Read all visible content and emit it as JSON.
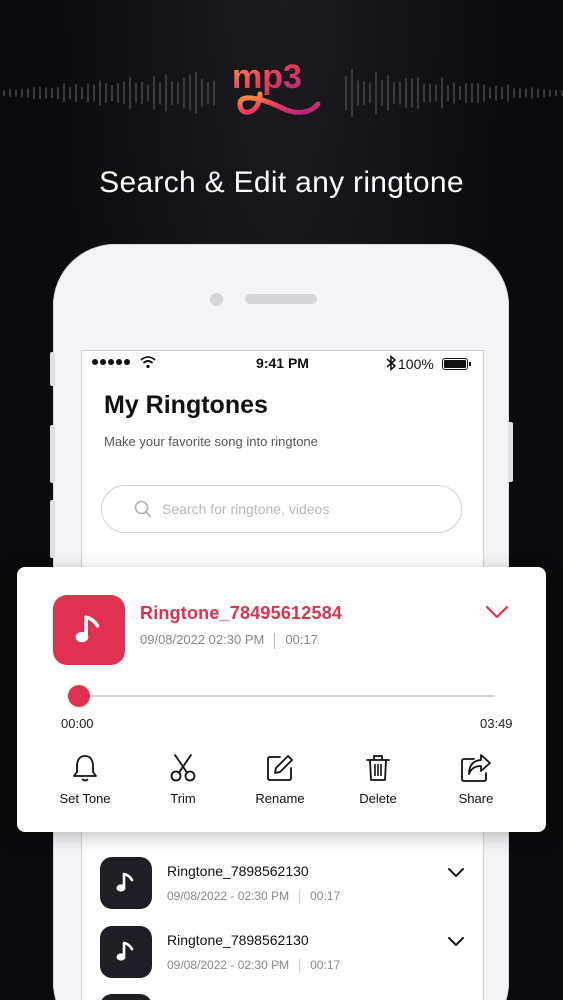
{
  "promo": {
    "logo_text": "mp3",
    "headline": "Search & Edit any ringtone"
  },
  "status_bar": {
    "time": "9:41 PM",
    "battery": "100%"
  },
  "screen": {
    "title": "My Ringtones",
    "subtitle": "Make your favorite song into ringtone",
    "search_placeholder": "Search for ringtone, videos"
  },
  "expanded": {
    "name": "Ringtone_78495612584",
    "date": "09/08/2022 02:30 PM",
    "duration": "00:17",
    "elapsed": "00:00",
    "total": "03:49",
    "progress": 0.0,
    "actions": [
      {
        "label": "Set Tone",
        "icon": "bell-icon"
      },
      {
        "label": "Trim",
        "icon": "scissors-icon"
      },
      {
        "label": "Rename",
        "icon": "edit-icon"
      },
      {
        "label": "Delete",
        "icon": "trash-icon"
      },
      {
        "label": "Share",
        "icon": "share-icon"
      }
    ]
  },
  "list": [
    {
      "name": "Ringtone_7898562130",
      "date": "09/08/2022 - 02:30 PM",
      "duration": "00:17"
    },
    {
      "name": "Ringtone_7898562130",
      "date": "09/08/2022 - 02:30 PM",
      "duration": "00:17"
    }
  ],
  "colors": {
    "accent": "#e03150",
    "background": "#0b0b0d",
    "thumb_dark": "#1e1e24"
  }
}
